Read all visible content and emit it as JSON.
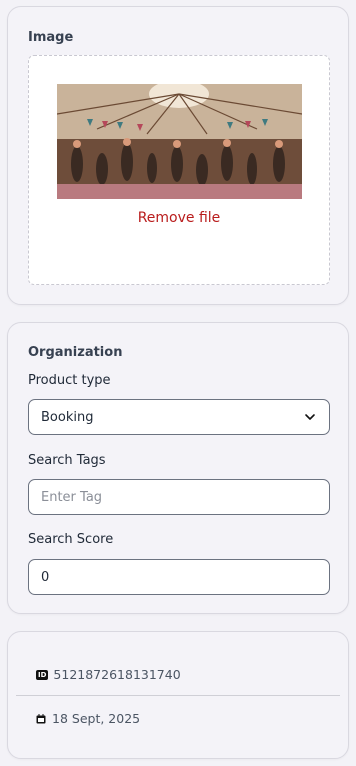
{
  "image_section": {
    "title": "Image",
    "remove_label": "Remove file"
  },
  "organization": {
    "title": "Organization",
    "product_type_label": "Product type",
    "product_type_value": "Booking",
    "search_tags_label": "Search Tags",
    "search_tags_placeholder": "Enter Tag",
    "search_score_label": "Search Score",
    "search_score_value": "0"
  },
  "meta": {
    "id_badge": "ID",
    "id_value": "5121872618131740",
    "date_value": "18 Sept, 2025"
  },
  "icons": {
    "chevron": "chevron-down-icon",
    "id": "id-badge-icon",
    "date": "calendar-icon"
  },
  "colors": {
    "remove_link": "#b91c1c",
    "background": "#f3f2f7"
  }
}
